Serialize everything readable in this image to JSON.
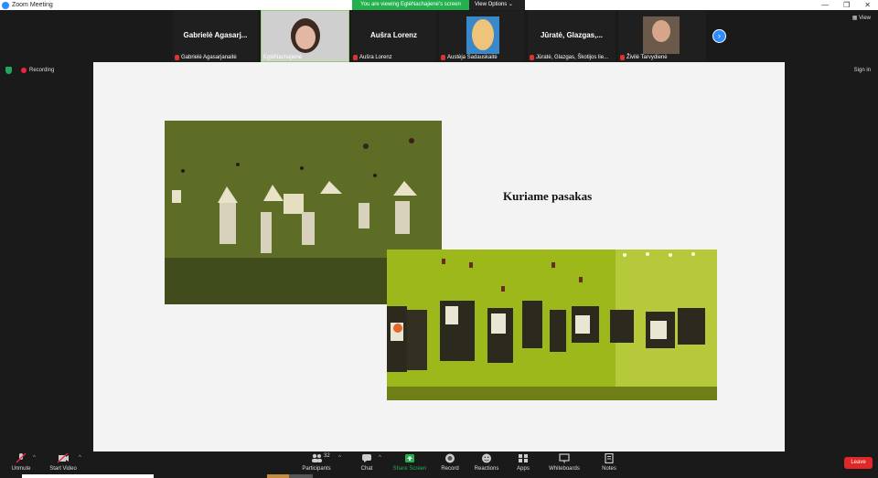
{
  "window": {
    "title": "Zoom Meeting",
    "controls": [
      "—",
      "❐",
      "✕"
    ]
  },
  "share_banner": {
    "viewing": "You are viewing EglėNachajienė's screen",
    "view_options": "View Options ⌄"
  },
  "strip": {
    "view_label": "View",
    "tiles": [
      {
        "big": "Gabrielė Agasarj...",
        "label": "Gabrielė Agasarjanaitė"
      },
      {
        "big": "",
        "label": "EglėNachajienė"
      },
      {
        "big": "Aušra Lorenz",
        "label": "Aušra Lorenz"
      },
      {
        "big": "",
        "label": "Austėja Sadauskaitė"
      },
      {
        "big": "Jūratė, Glazgas,...",
        "label": "Jūratė, Glazgas, Škotijos lie..."
      },
      {
        "big": "",
        "label": "Živilė Tarvydienė"
      }
    ]
  },
  "status": {
    "recording": "Recording",
    "signin": "Sign in"
  },
  "slide": {
    "title": "Kuriame pasakas"
  },
  "toolbar": {
    "unmute": "Unmute",
    "start_video": "Start Video",
    "participants": "Participants",
    "participants_count": "32",
    "chat": "Chat",
    "share_screen": "Share Screen",
    "record": "Record",
    "reactions": "Reactions",
    "apps": "Apps",
    "whiteboards": "Whiteboards",
    "notes": "Notes",
    "leave": "Leave"
  },
  "colors": {
    "accent": "#2d8cff",
    "share_green": "#22b14c",
    "leave_red": "#e02828"
  }
}
